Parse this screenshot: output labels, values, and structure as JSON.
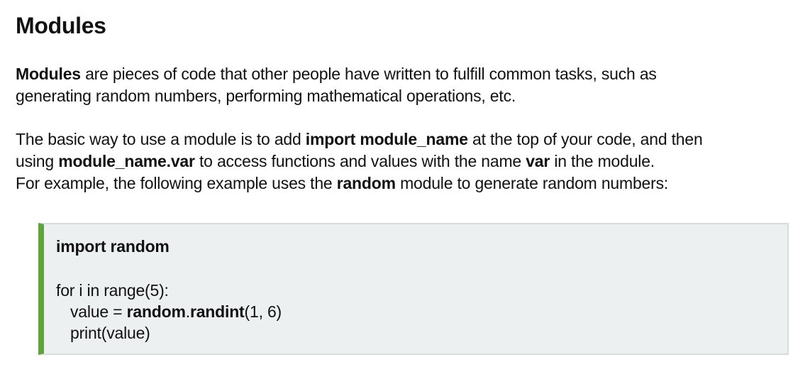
{
  "heading": "Modules",
  "intro": {
    "term": "Modules",
    "line1_rest": " are pieces of code that other people have written to fulfill common tasks, such as",
    "line2": "generating random numbers, performing mathematical operations, etc."
  },
  "usage": {
    "line1_start": "The basic way to use a module is to add ",
    "line1_code": "import module_name",
    "line1_end": " at the top of your code, and then",
    "line2_start": "using ",
    "line2_code": "module_name.var",
    "line2_mid": " to access functions and values with the name ",
    "line2_var": "var",
    "line2_end": " in the module.",
    "line3_start": "For example, the following example uses the ",
    "line3_module": "random",
    "line3_end": " module to generate random numbers:"
  },
  "code": {
    "line1": "import random",
    "line2": "for i in range(5):",
    "line3_start": "value = ",
    "line3_module": "random",
    "line3_dot": ".",
    "line3_func": "randint",
    "line3_args": "(1, 6)",
    "line4": "print(value)"
  },
  "colors": {
    "accent_border": "#5fa33d",
    "code_background": "#ecf0f0"
  }
}
